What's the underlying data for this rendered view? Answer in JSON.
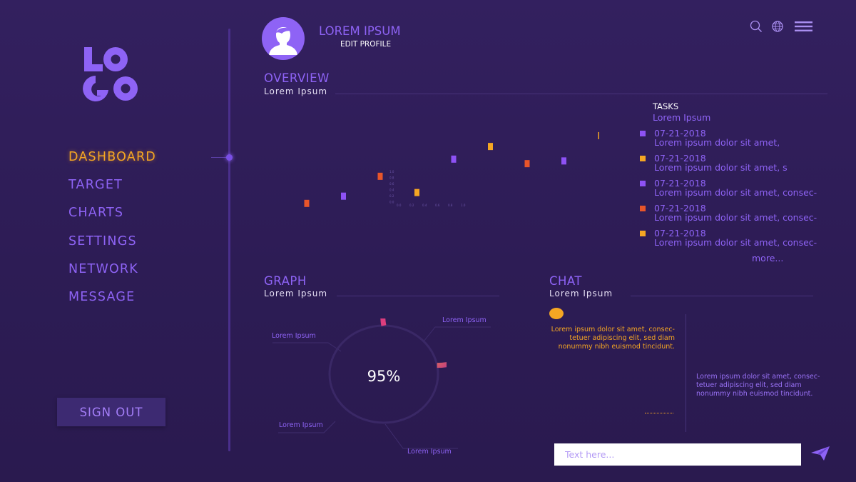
{
  "brand": {
    "logo_text": "LOGO"
  },
  "profile": {
    "name": "LOREM IPSUM",
    "edit_label": "EDIT PROFILE"
  },
  "header_icons": [
    "search-icon",
    "globe-icon",
    "menu-icon"
  ],
  "nav": {
    "items": [
      {
        "label": "DASHBOARD",
        "active": true
      },
      {
        "label": "TARGET",
        "active": false
      },
      {
        "label": "CHARTS",
        "active": false
      },
      {
        "label": "SETTINGS",
        "active": false
      },
      {
        "label": "NETWORK",
        "active": false
      },
      {
        "label": "MESSAGE",
        "active": false
      }
    ],
    "signout_label": "SIGN OUT"
  },
  "overview": {
    "title": "OVERVIEW",
    "subtitle": "Lorem Ipsum"
  },
  "tasks": {
    "title": "TASKS",
    "subtitle": "Lorem Ipsum",
    "items": [
      {
        "date": "07-21-2018",
        "text": "Lorem ipsum dolor sit amet,",
        "color": "#8e52f5"
      },
      {
        "date": "07-21-2018",
        "text": "Lorem ipsum dolor sit amet, s",
        "color": "#f5a623"
      },
      {
        "date": "07-21-2018",
        "text": "Lorem ipsum dolor sit amet, consec-",
        "color": "#8e52f5"
      },
      {
        "date": "07-21-2018",
        "text": "Lorem ipsum dolor sit amet, consec-",
        "color": "#e8552a"
      },
      {
        "date": "07-21-2018",
        "text": "Lorem ipsum dolor sit amet, consec-",
        "color": "#f5a623"
      }
    ],
    "more_label": "more..."
  },
  "graph": {
    "title": "GRAPH",
    "subtitle": "Lorem Ipsum",
    "value_label": "95%",
    "callouts": [
      "Lorem Ipsum",
      "Lorem Ipsum",
      "Lorem Ipsum",
      "Lorem Ipsum"
    ]
  },
  "chat": {
    "title": "CHAT",
    "subtitle": "Lorem Ipsum",
    "message_left": "Lorem ipsum dolor sit amet, consec-tetuer adipiscing elit, sed diam nonummy nibh euismod tincidunt.",
    "message_right": "Lorem ipsum dolor sit amet, consec-tetuer adipiscing elit, sed diam nonummy nibh euismod tincidunt.",
    "input_placeholder": "Text here..."
  },
  "colors": {
    "accent": "#8e63f5",
    "active": "#f5a623",
    "background": "#2e1d57",
    "orange_red": "#e8552a"
  },
  "chart_data": {
    "type": "scatter",
    "points": [
      {
        "x": 1,
        "y": 1.2,
        "color": "#e8552a"
      },
      {
        "x": 2,
        "y": 2.0,
        "color": "#8e52f5"
      },
      {
        "x": 3,
        "y": 4.2,
        "color": "#e8552a"
      },
      {
        "x": 4,
        "y": 2.4,
        "color": "#f5a623"
      },
      {
        "x": 5,
        "y": 6.1,
        "color": "#8e52f5"
      },
      {
        "x": 6,
        "y": 7.5,
        "color": "#f5a623"
      },
      {
        "x": 7,
        "y": 5.6,
        "color": "#e8552a"
      },
      {
        "x": 8,
        "y": 5.9,
        "color": "#8e52f5"
      },
      {
        "x": 9,
        "y": 8.7,
        "color": "#f5a623"
      }
    ],
    "inset_y_ticks": [
      "1.0",
      "0.8",
      "0.6",
      "0.4",
      "0.2",
      "0.0"
    ],
    "inset_x_ticks": [
      "0.0",
      "0.2",
      "0.4",
      "0.6",
      "0.8",
      "1.0"
    ],
    "ylim": [
      0,
      10
    ],
    "grid": false,
    "legend": "none"
  }
}
